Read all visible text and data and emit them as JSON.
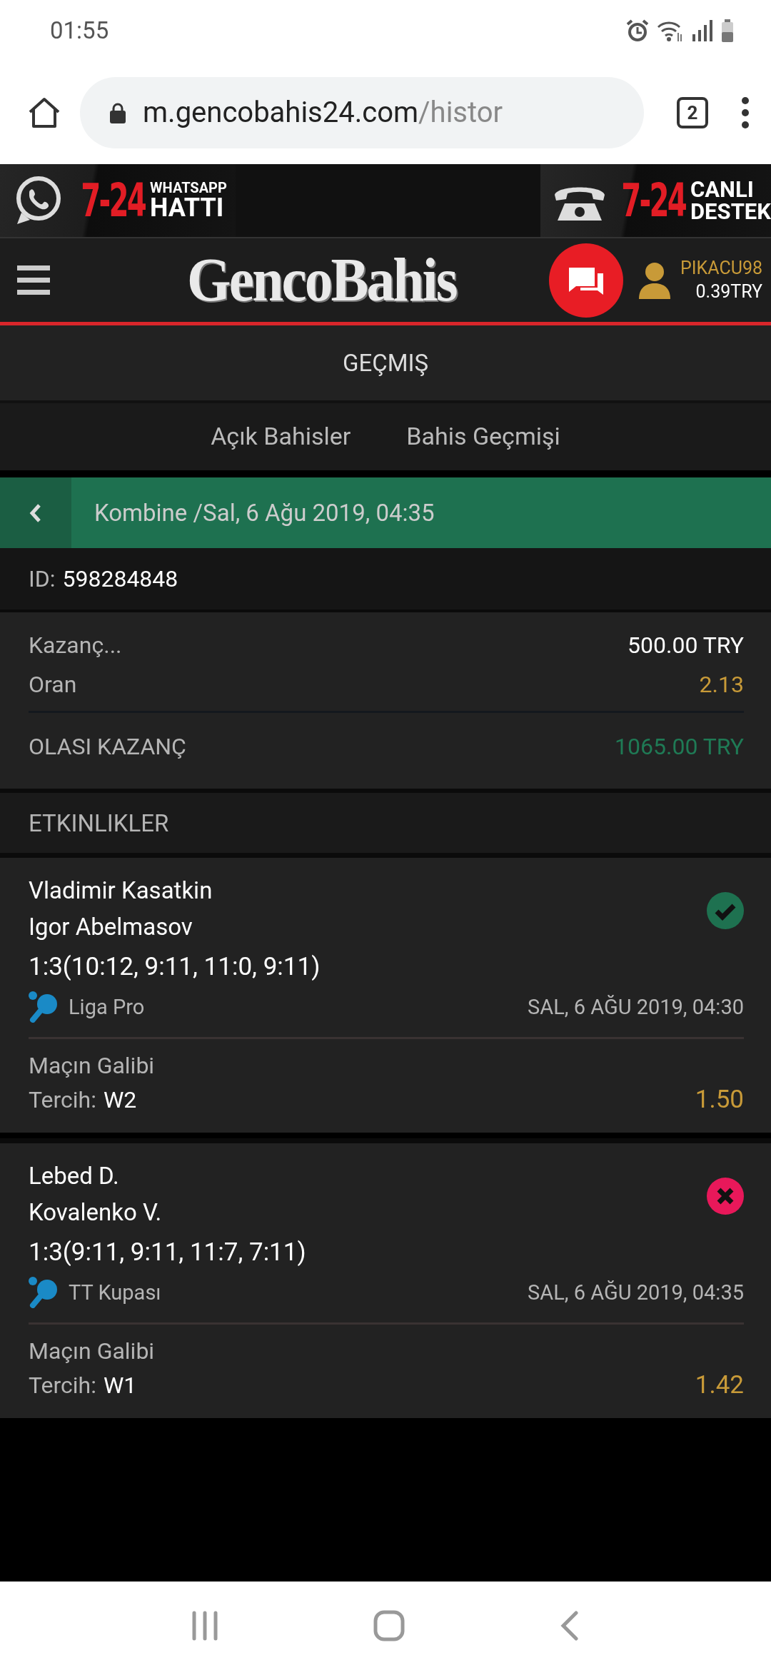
{
  "status_bar": {
    "time": "01:55"
  },
  "browser": {
    "url_host": "m.gencobahis24.com",
    "url_path": "/histor",
    "tab_count": "2"
  },
  "banner": [
    {
      "number": "7-24",
      "top": "WHATSAPP",
      "bottom": "HATTI",
      "kind": "whatsapp"
    },
    {
      "number": "7-24",
      "top": "CANLI",
      "bottom": "DESTEK",
      "kind": "phone"
    }
  ],
  "header": {
    "logo": "GencoBahis",
    "username": "PIKACU98",
    "balance": "0.39TRY"
  },
  "page_title": "GEÇMIŞ",
  "tabs": [
    {
      "label": "Açık Bahisler",
      "selected": false
    },
    {
      "label": "Bahis Geçmişi",
      "selected": false
    }
  ],
  "bet": {
    "title": "Kombine /Sal, 6 Ağu 2019, 04:35",
    "id_label": "ID:",
    "id": "598284848",
    "summary": [
      {
        "label": "Kazanç...",
        "value": "500.00 TRY",
        "kind": "stake"
      },
      {
        "label": "Oran",
        "value": "2.13",
        "kind": "odds"
      }
    ],
    "payout": {
      "label": "OLASI KAZANÇ",
      "value": "1065.00 TRY"
    }
  },
  "events_title": "ETKINLIKLER",
  "events": [
    {
      "team1": "Vladimir Kasatkin",
      "team2": "Igor Abelmasov",
      "score": "1:3(10:12, 9:11, 11:0, 9:11)",
      "league": "Liga Pro",
      "date": "SAL, 6 AĞU 2019, 04:30",
      "market": "Maçın Galibi",
      "pick_label": "Tercih:",
      "pick": "W2",
      "odds": "1.50",
      "won": true
    },
    {
      "team1": "Lebed D.",
      "team2": "Kovalenko V.",
      "score": "1:3(9:11, 9:11, 11:7, 7:11)",
      "league": "TT Kupası",
      "date": "SAL, 6 AĞU 2019, 04:35",
      "market": "Maçın Galibi",
      "pick_label": "Tercih:",
      "pick": "W1",
      "odds": "1.42",
      "won": false
    }
  ]
}
